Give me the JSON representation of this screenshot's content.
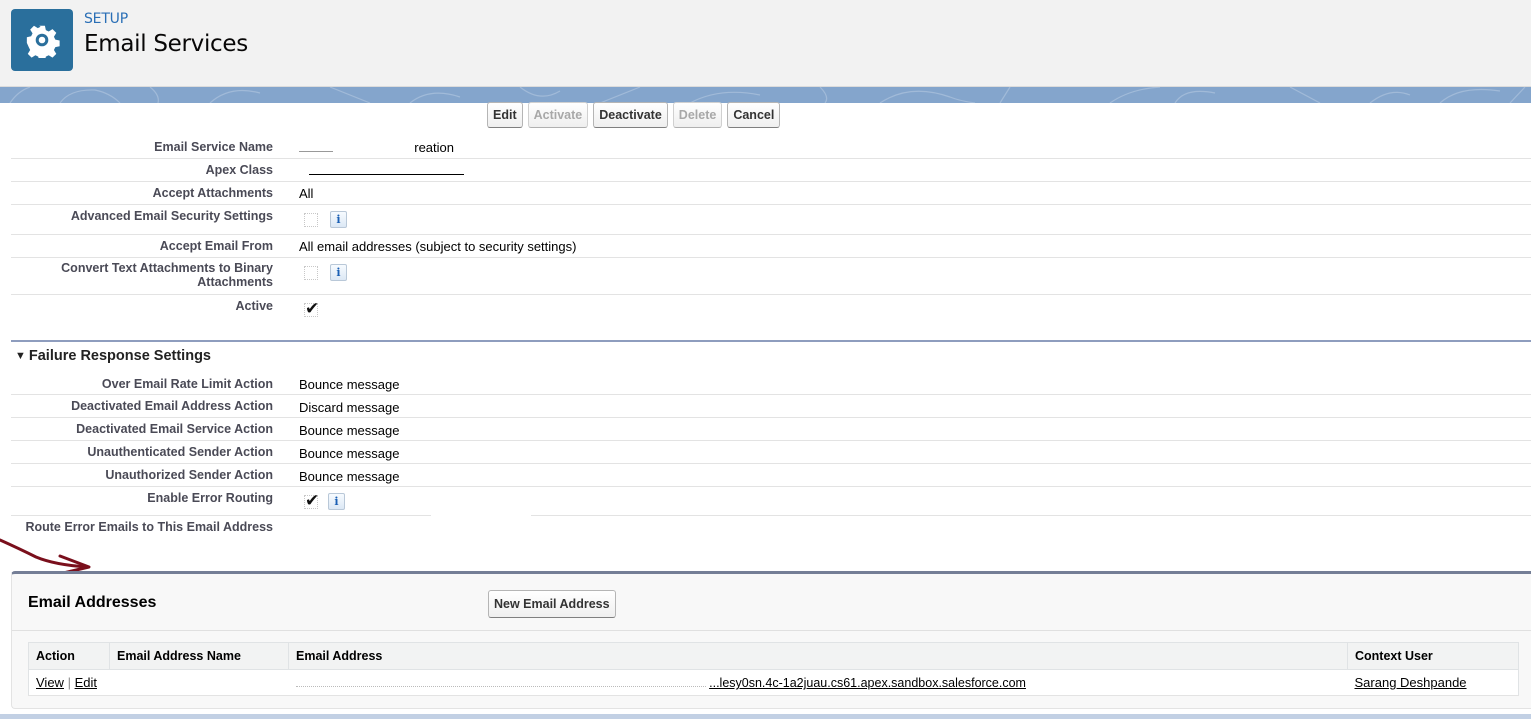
{
  "header": {
    "eyebrow": "SETUP",
    "title": "Email Services",
    "icon": "gear-icon",
    "icon_bg": "#2a6f9c"
  },
  "toolbar": {
    "buttons": [
      {
        "label": "Edit",
        "enabled": true
      },
      {
        "label": "Activate",
        "enabled": false
      },
      {
        "label": "Deactivate",
        "enabled": true
      },
      {
        "label": "Delete",
        "enabled": false
      },
      {
        "label": "Cancel",
        "enabled": true
      }
    ]
  },
  "details": {
    "email_service_name": {
      "label": "Email Service Name",
      "value_visible": "reation"
    },
    "apex_class": {
      "label": "Apex Class",
      "value": ""
    },
    "accept_attachments": {
      "label": "Accept Attachments",
      "value": "All"
    },
    "advanced_security": {
      "label": "Advanced Email Security Settings",
      "checked": false
    },
    "accept_email_from": {
      "label": "Accept Email From",
      "value": "All email addresses (subject to security settings)"
    },
    "convert_text": {
      "label": "Convert Text Attachments to Binary Attachments",
      "checked": false
    },
    "active": {
      "label": "Active",
      "checked": true
    }
  },
  "failure_section": {
    "title": "Failure Response Settings",
    "rows": [
      {
        "label": "Over Email Rate Limit Action",
        "value": "Bounce message"
      },
      {
        "label": "Deactivated Email Address Action",
        "value": "Discard message"
      },
      {
        "label": "Deactivated Email Service Action",
        "value": "Bounce message"
      },
      {
        "label": "Unauthenticated Sender Action",
        "value": "Bounce message"
      },
      {
        "label": "Unauthorized Sender Action",
        "value": "Bounce message"
      }
    ],
    "enable_error_routing": {
      "label": "Enable Error Routing",
      "checked": true
    },
    "route_error_emails": {
      "label": "Route Error Emails to This Email Address",
      "value": ""
    }
  },
  "email_addresses": {
    "title": "Email Addresses",
    "new_button": "New Email Address",
    "columns": [
      "Action",
      "Email Address Name",
      "Email Address",
      "Context User"
    ],
    "rows": [
      {
        "action_view": "View",
        "action_sep": "|",
        "action_edit": "Edit",
        "name": "",
        "address_visible": "...lesy0sn.4c-1a2juau.cs61.apex.sandbox.salesforce.com",
        "context_user": "Sarang Deshpande"
      }
    ]
  },
  "colors": {
    "accent_blue": "#2a6fb6",
    "band": "#84a5cc",
    "section_rule": "#8e9dbe",
    "annotation": "#7a0f1c"
  }
}
